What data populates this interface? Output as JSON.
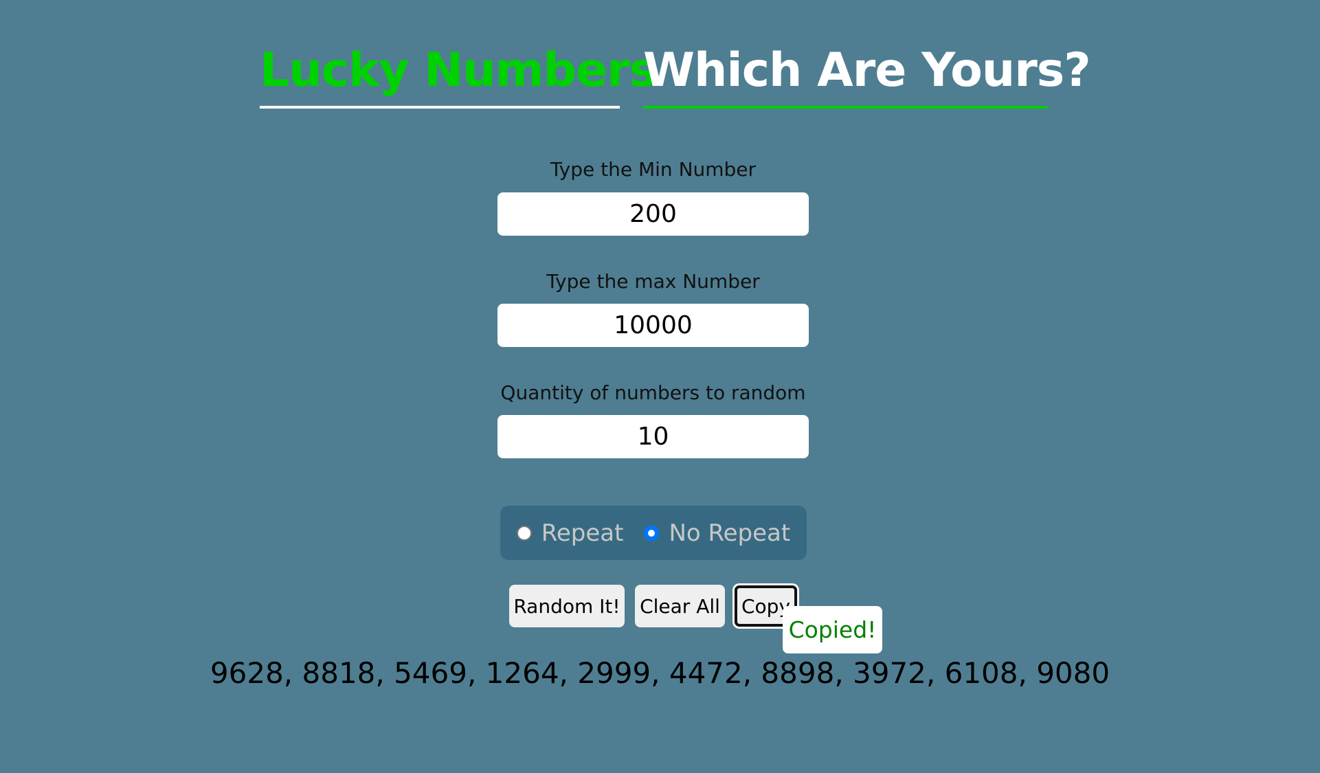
{
  "header": {
    "title_part1": "Lucky Numbers",
    "title_part2": "Which Are Yours?"
  },
  "form": {
    "min_label": "Type the Min Number",
    "min_value": "200",
    "max_label": "Type the max Number",
    "max_value": "10000",
    "qty_label": "Quantity of numbers to random",
    "qty_value": "10"
  },
  "mode": {
    "options": [
      "Repeat",
      "No Repeat"
    ],
    "selected": "No Repeat"
  },
  "buttons": {
    "random": "Random It!",
    "clear": "Clear All",
    "copy": "Copy"
  },
  "tooltip": "Copied!",
  "result": "9628, 8818, 5469, 1264, 2999, 4472, 8898, 3972, 6108, 9080",
  "colors": {
    "background": "#4f7e92",
    "accent": "#00d100",
    "panel": "#376a82",
    "tooltip_text": "#008000"
  }
}
